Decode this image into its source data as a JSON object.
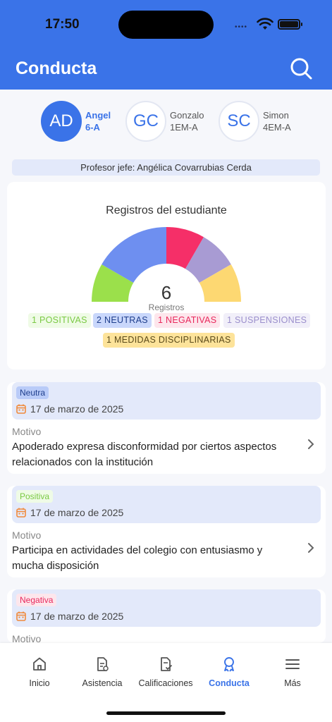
{
  "status": {
    "time": "17:50",
    "dots": "••••"
  },
  "header": {
    "title": "Conducta"
  },
  "students": [
    {
      "initials": "AD",
      "name": "Angel",
      "course": "6-A",
      "active": true
    },
    {
      "initials": "GC",
      "name": "Gonzalo",
      "course": "1EM-A",
      "active": false
    },
    {
      "initials": "SC",
      "name": "Simon",
      "course": "4EM-A",
      "active": false
    }
  ],
  "teacher": {
    "text": "Profesor jefe: Angélica Covarrubias Cerda"
  },
  "summary": {
    "title": "Registros del estudiante",
    "count": "6",
    "count_label": "Registros",
    "chips": [
      {
        "label": "1 POSITIVAS",
        "color": "#7ac943",
        "bg": "#effbe6"
      },
      {
        "label": "2 NEUTRAS",
        "color": "#1e3e8c",
        "bg": "#c9d7fb"
      },
      {
        "label": "1 NEGATIVAS",
        "color": "#e8285c",
        "bg": "#fde6ec"
      },
      {
        "label": "1 SUSPENSIONES",
        "color": "#9b8fcc",
        "bg": "#f1eff9"
      },
      {
        "label": "1 MEDIDAS DISCIPLINARIAS",
        "color": "#5a4a1a",
        "bg": "#fde39a"
      }
    ]
  },
  "chart_data": {
    "type": "pie",
    "categories": [
      "Positivas",
      "Neutras",
      "Negativas",
      "Suspensiones",
      "Medidas disciplinarias"
    ],
    "values": [
      1,
      2,
      1,
      1,
      1
    ],
    "colors": [
      "#9be04b",
      "#6e8ff0",
      "#f52f68",
      "#a89bd3",
      "#fdd872"
    ]
  },
  "records": [
    {
      "type": "Neutra",
      "tag_color": "#1e3e8c",
      "tag_bg": "#b9cbf8",
      "date": "17 de marzo de 2025",
      "motivo_label": "Motivo",
      "motivo": "Apoderado expresa disconformidad por ciertos aspectos relacionados con la institución"
    },
    {
      "type": "Positiva",
      "tag_color": "#7ac943",
      "tag_bg": "#effbe6",
      "date": "17 de marzo de 2025",
      "motivo_label": "Motivo",
      "motivo": "Participa en actividades del colegio con entusiasmo y mucha disposición"
    },
    {
      "type": "Negativa",
      "tag_color": "#e8285c",
      "tag_bg": "#fde6ec",
      "date": "17 de marzo de 2025",
      "motivo_label": "Motivo",
      "motivo": ""
    }
  ],
  "tabs": [
    {
      "label": "Inicio",
      "icon": "home-icon",
      "active": false
    },
    {
      "label": "Asistencia",
      "icon": "attendance-icon",
      "active": false
    },
    {
      "label": "Calificaciones",
      "icon": "grades-icon",
      "active": false
    },
    {
      "label": "Conducta",
      "icon": "award-icon",
      "active": true
    },
    {
      "label": "Más",
      "icon": "menu-icon",
      "active": false
    }
  ],
  "colors": {
    "accent": "#3a73e8",
    "date_icon": "#f08a3c"
  }
}
